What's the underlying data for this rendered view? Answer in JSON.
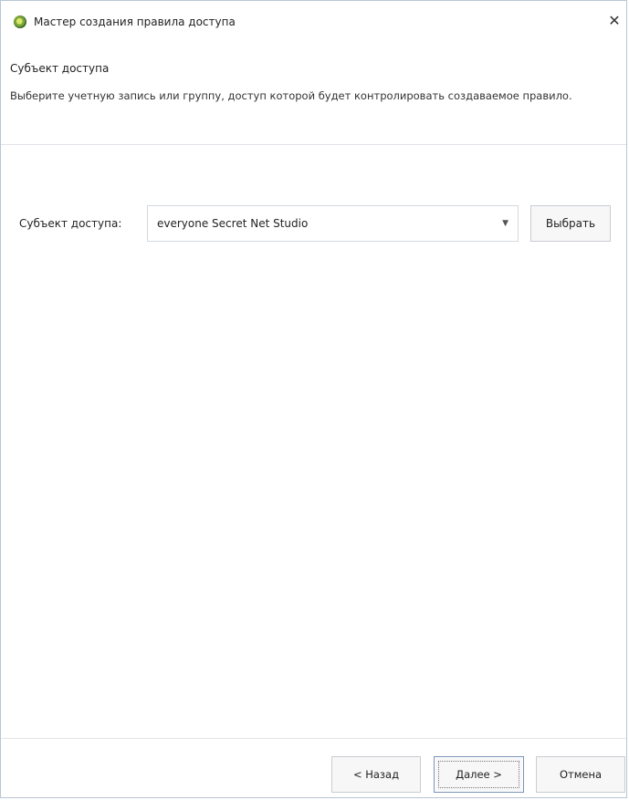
{
  "window": {
    "title": "Мастер создания правила доступа",
    "close_glyph": "✕"
  },
  "header": {
    "step_title": "Субъект доступа",
    "description": "Выберите учетную запись или группу, доступ которой будет контролировать создаваемое правило."
  },
  "subject": {
    "label": "Субъект доступа:",
    "value": "everyone Secret Net Studio",
    "dropdown_glyph": "▼",
    "choose_label": "Выбрать"
  },
  "footer": {
    "back_label": "< Назад",
    "next_label": "Далее >",
    "cancel_label": "Отмена"
  }
}
